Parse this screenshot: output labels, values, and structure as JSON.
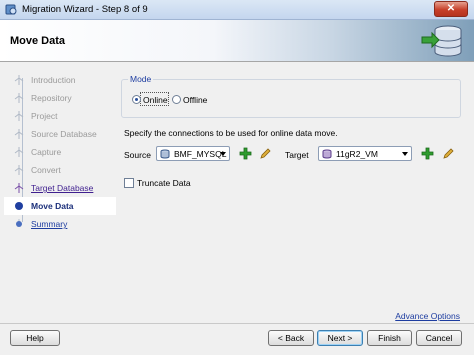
{
  "window": {
    "title": "Migration Wizard - Step 8 of 9",
    "close_label": "✕"
  },
  "header": {
    "title": "Move Data"
  },
  "steps": [
    {
      "label": "Introduction",
      "state": "done"
    },
    {
      "label": "Repository",
      "state": "done"
    },
    {
      "label": "Project",
      "state": "done"
    },
    {
      "label": "Source Database",
      "state": "done"
    },
    {
      "label": "Capture",
      "state": "done"
    },
    {
      "label": "Convert",
      "state": "done"
    },
    {
      "label": "Target Database",
      "state": "link"
    },
    {
      "label": "Move Data",
      "state": "current"
    },
    {
      "label": "Summary",
      "state": "future"
    }
  ],
  "mode": {
    "label": "Mode",
    "options": [
      {
        "label": "Online",
        "selected": true
      },
      {
        "label": "Offline",
        "selected": false
      }
    ]
  },
  "instructions": "Specify the connections to be used for online data move.",
  "source": {
    "label": "Source",
    "value": "BMF_MYSQL"
  },
  "target": {
    "label": "Target",
    "value": "11gR2_VM"
  },
  "truncate": {
    "label": "Truncate Data",
    "checked": false
  },
  "advance_options_link": "Advance Options",
  "buttons": {
    "help": "Help",
    "back": "< Back",
    "next": "Next >",
    "finish": "Finish",
    "cancel": "Cancel"
  },
  "colors": {
    "accent": "#1e3da0",
    "add_icon": "#2e9c2e",
    "edit_icon": "#d49a1a",
    "close": "#c7402a"
  }
}
